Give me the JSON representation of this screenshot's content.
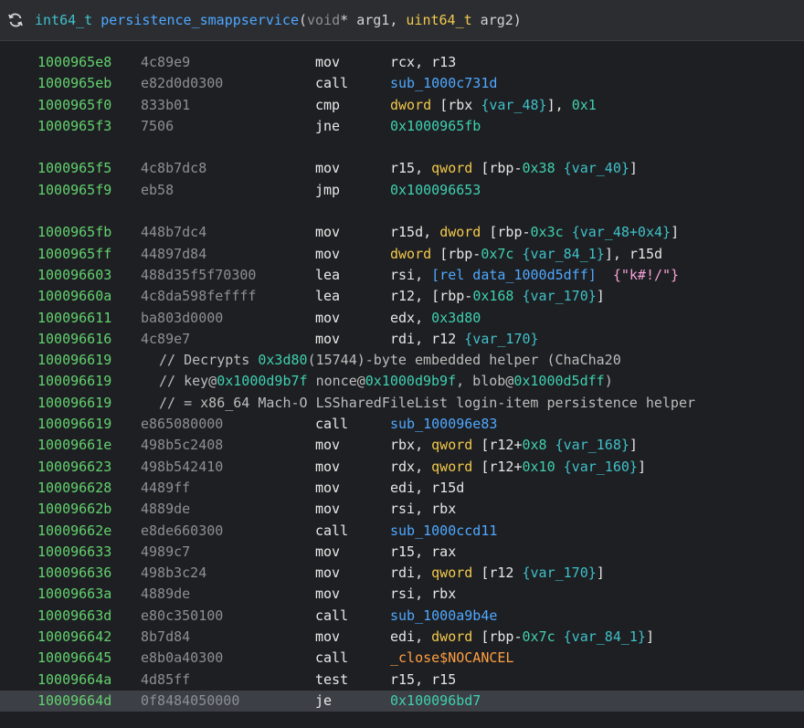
{
  "header": {
    "ret_type": "int64_t",
    "func_name": "persistence_smappservice",
    "open_paren": "(",
    "p1_type": "void",
    "p1_ptr": "*",
    "p1_name": " arg1, ",
    "p2_type": "uint64_t",
    "p2_name": " arg2)",
    "icon": "refresh-icon"
  },
  "rows": [
    {
      "addr": "1000965e8",
      "bytes": "4c89e9",
      "mn": "mov",
      "ops": [
        [
          "reg",
          "rcx, r13"
        ]
      ]
    },
    {
      "addr": "1000965eb",
      "bytes": "e82d0d0300",
      "mn": "call",
      "ops": [
        [
          "sym",
          "sub_1000c731d"
        ]
      ]
    },
    {
      "addr": "1000965f0",
      "bytes": "833b01",
      "mn": "cmp",
      "ops": [
        [
          "size",
          "dword "
        ],
        [
          "reg",
          "[rbx "
        ],
        [
          "var",
          "{var_48}"
        ],
        [
          "reg",
          "], "
        ],
        [
          "num",
          "0x1"
        ]
      ]
    },
    {
      "addr": "1000965f3",
      "bytes": "7506",
      "mn": "jne",
      "ops": [
        [
          "num",
          "0x1000965fb"
        ]
      ]
    },
    {
      "gap": true
    },
    {
      "addr": "1000965f5",
      "bytes": "4c8b7dc8",
      "mn": "mov",
      "ops": [
        [
          "reg",
          "r15, "
        ],
        [
          "size",
          "qword "
        ],
        [
          "reg",
          "[rbp-"
        ],
        [
          "num",
          "0x38"
        ],
        [
          "reg",
          " "
        ],
        [
          "var",
          "{var_40}"
        ],
        [
          "reg",
          "]"
        ]
      ]
    },
    {
      "addr": "1000965f9",
      "bytes": "eb58",
      "mn": "jmp",
      "ops": [
        [
          "num",
          "0x100096653"
        ]
      ]
    },
    {
      "gap": true
    },
    {
      "addr": "1000965fb",
      "bytes": "448b7dc4",
      "mn": "mov",
      "ops": [
        [
          "reg",
          "r15d, "
        ],
        [
          "size",
          "dword "
        ],
        [
          "reg",
          "[rbp-"
        ],
        [
          "num",
          "0x3c"
        ],
        [
          "reg",
          " "
        ],
        [
          "var",
          "{var_48+0x4}"
        ],
        [
          "reg",
          "]"
        ]
      ]
    },
    {
      "addr": "1000965ff",
      "bytes": "44897d84",
      "mn": "mov",
      "ops": [
        [
          "size",
          "dword "
        ],
        [
          "reg",
          "[rbp-"
        ],
        [
          "num",
          "0x7c"
        ],
        [
          "reg",
          " "
        ],
        [
          "var",
          "{var_84_1}"
        ],
        [
          "reg",
          "], r15d"
        ]
      ]
    },
    {
      "addr": "100096603",
      "bytes": "488d35f5f70300",
      "mn": "lea",
      "ops": [
        [
          "reg",
          "rsi, "
        ],
        [
          "sym",
          "[rel data_1000d5dff]"
        ],
        [
          "reg",
          "  "
        ],
        [
          "str",
          "{\"k#!/\"}"
        ]
      ]
    },
    {
      "addr": "10009660a",
      "bytes": "4c8da598feffff",
      "mn": "lea",
      "ops": [
        [
          "reg",
          "r12, [rbp-"
        ],
        [
          "num",
          "0x168"
        ],
        [
          "reg",
          " "
        ],
        [
          "var",
          "{var_170}"
        ],
        [
          "reg",
          "]"
        ]
      ]
    },
    {
      "addr": "100096611",
      "bytes": "ba803d0000",
      "mn": "mov",
      "ops": [
        [
          "reg",
          "edx, "
        ],
        [
          "num",
          "0x3d80"
        ]
      ]
    },
    {
      "addr": "100096616",
      "bytes": "4c89e7",
      "mn": "mov",
      "ops": [
        [
          "reg",
          "rdi, r12 "
        ],
        [
          "var",
          "{var_170}"
        ]
      ]
    },
    {
      "addr": "100096619",
      "comment": [
        [
          "c",
          "// Decrypts "
        ],
        [
          "num",
          "0x3d80"
        ],
        [
          "c",
          "(15744)-byte embedded helper (ChaCha20"
        ]
      ]
    },
    {
      "addr": "100096619",
      "comment": [
        [
          "c",
          "// key@"
        ],
        [
          "num",
          "0x1000d9b7f"
        ],
        [
          "c",
          " nonce@"
        ],
        [
          "num",
          "0x1000d9b9f"
        ],
        [
          "c",
          ", blob@"
        ],
        [
          "num",
          "0x1000d5dff"
        ],
        [
          "c",
          ")"
        ]
      ]
    },
    {
      "addr": "100096619",
      "comment": [
        [
          "c",
          "// = x86_64 Mach-O LSSharedFileList login-item persistence helper"
        ]
      ]
    },
    {
      "addr": "100096619",
      "bytes": "e865080000",
      "mn": "call",
      "ops": [
        [
          "sym",
          "sub_100096e83"
        ]
      ]
    },
    {
      "addr": "10009661e",
      "bytes": "498b5c2408",
      "mn": "mov",
      "ops": [
        [
          "reg",
          "rbx, "
        ],
        [
          "size",
          "qword "
        ],
        [
          "reg",
          "[r12+"
        ],
        [
          "num",
          "0x8"
        ],
        [
          "reg",
          " "
        ],
        [
          "var",
          "{var_168}"
        ],
        [
          "reg",
          "]"
        ]
      ]
    },
    {
      "addr": "100096623",
      "bytes": "498b542410",
      "mn": "mov",
      "ops": [
        [
          "reg",
          "rdx, "
        ],
        [
          "size",
          "qword "
        ],
        [
          "reg",
          "[r12+"
        ],
        [
          "num",
          "0x10"
        ],
        [
          "reg",
          " "
        ],
        [
          "var",
          "{var_160}"
        ],
        [
          "reg",
          "]"
        ]
      ]
    },
    {
      "addr": "100096628",
      "bytes": "4489ff",
      "mn": "mov",
      "ops": [
        [
          "reg",
          "edi, r15d"
        ]
      ]
    },
    {
      "addr": "10009662b",
      "bytes": "4889de",
      "mn": "mov",
      "ops": [
        [
          "reg",
          "rsi, rbx"
        ]
      ]
    },
    {
      "addr": "10009662e",
      "bytes": "e8de660300",
      "mn": "call",
      "ops": [
        [
          "sym",
          "sub_1000ccd11"
        ]
      ]
    },
    {
      "addr": "100096633",
      "bytes": "4989c7",
      "mn": "mov",
      "ops": [
        [
          "reg",
          "r15, rax"
        ]
      ]
    },
    {
      "addr": "100096636",
      "bytes": "498b3c24",
      "mn": "mov",
      "ops": [
        [
          "reg",
          "rdi, "
        ],
        [
          "size",
          "qword "
        ],
        [
          "reg",
          "[r12 "
        ],
        [
          "var",
          "{var_170}"
        ],
        [
          "reg",
          "]"
        ]
      ]
    },
    {
      "addr": "10009663a",
      "bytes": "4889de",
      "mn": "mov",
      "ops": [
        [
          "reg",
          "rsi, rbx"
        ]
      ]
    },
    {
      "addr": "10009663d",
      "bytes": "e80c350100",
      "mn": "call",
      "ops": [
        [
          "sym",
          "sub_1000a9b4e"
        ]
      ]
    },
    {
      "addr": "100096642",
      "bytes": "8b7d84",
      "mn": "mov",
      "ops": [
        [
          "reg",
          "edi, "
        ],
        [
          "size",
          "dword "
        ],
        [
          "reg",
          "[rbp-"
        ],
        [
          "num",
          "0x7c"
        ],
        [
          "reg",
          " "
        ],
        [
          "var",
          "{var_84_1}"
        ],
        [
          "reg",
          "]"
        ]
      ]
    },
    {
      "addr": "100096645",
      "bytes": "e8b0a40300",
      "mn": "call",
      "ops": [
        [
          "imp",
          "_close$NOCANCEL"
        ]
      ]
    },
    {
      "addr": "10009664a",
      "bytes": "4d85ff",
      "mn": "test",
      "ops": [
        [
          "reg",
          "r15, r15"
        ]
      ]
    },
    {
      "addr": "10009664d",
      "bytes": "0f8484050000",
      "mn": "je",
      "ops": [
        [
          "num",
          "0x100096bd7"
        ]
      ],
      "selected": true
    }
  ]
}
